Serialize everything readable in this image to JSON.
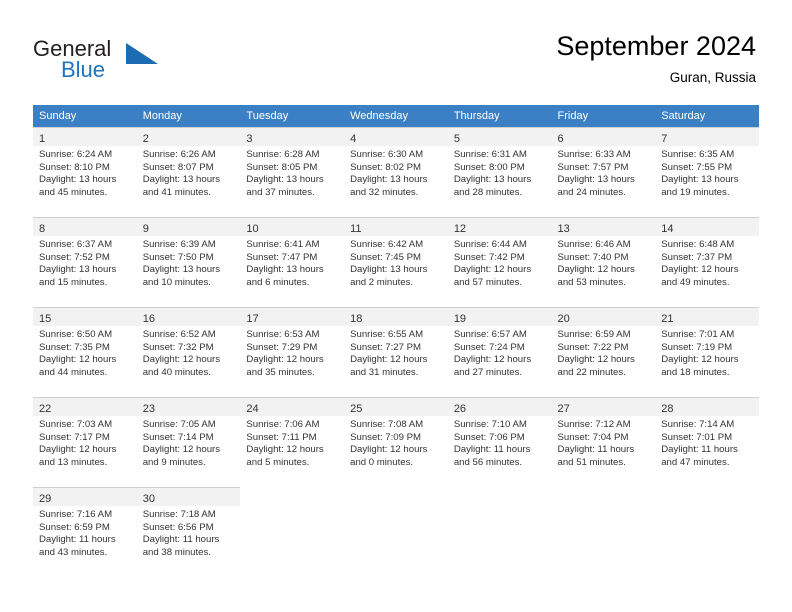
{
  "brand": {
    "name_part1": "General",
    "name_part2": "Blue",
    "logo_icon": "triangle-logo-icon",
    "accent_color": "#2175bc"
  },
  "header": {
    "title": "September 2024",
    "subtitle": "Guran, Russia"
  },
  "calendar": {
    "header_bg_color": "#3b7fc4",
    "weekday_headers": [
      "Sunday",
      "Monday",
      "Tuesday",
      "Wednesday",
      "Thursday",
      "Friday",
      "Saturday"
    ],
    "labels": {
      "sunrise": "Sunrise:",
      "sunset": "Sunset:",
      "daylight": "Daylight:"
    },
    "weeks": [
      [
        {
          "day": "1",
          "sunrise": "Sunrise: 6:24 AM",
          "sunset": "Sunset: 8:10 PM",
          "daylight_1": "Daylight: 13 hours",
          "daylight_2": "and 45 minutes."
        },
        {
          "day": "2",
          "sunrise": "Sunrise: 6:26 AM",
          "sunset": "Sunset: 8:07 PM",
          "daylight_1": "Daylight: 13 hours",
          "daylight_2": "and 41 minutes."
        },
        {
          "day": "3",
          "sunrise": "Sunrise: 6:28 AM",
          "sunset": "Sunset: 8:05 PM",
          "daylight_1": "Daylight: 13 hours",
          "daylight_2": "and 37 minutes."
        },
        {
          "day": "4",
          "sunrise": "Sunrise: 6:30 AM",
          "sunset": "Sunset: 8:02 PM",
          "daylight_1": "Daylight: 13 hours",
          "daylight_2": "and 32 minutes."
        },
        {
          "day": "5",
          "sunrise": "Sunrise: 6:31 AM",
          "sunset": "Sunset: 8:00 PM",
          "daylight_1": "Daylight: 13 hours",
          "daylight_2": "and 28 minutes."
        },
        {
          "day": "6",
          "sunrise": "Sunrise: 6:33 AM",
          "sunset": "Sunset: 7:57 PM",
          "daylight_1": "Daylight: 13 hours",
          "daylight_2": "and 24 minutes."
        },
        {
          "day": "7",
          "sunrise": "Sunrise: 6:35 AM",
          "sunset": "Sunset: 7:55 PM",
          "daylight_1": "Daylight: 13 hours",
          "daylight_2": "and 19 minutes."
        }
      ],
      [
        {
          "day": "8",
          "sunrise": "Sunrise: 6:37 AM",
          "sunset": "Sunset: 7:52 PM",
          "daylight_1": "Daylight: 13 hours",
          "daylight_2": "and 15 minutes."
        },
        {
          "day": "9",
          "sunrise": "Sunrise: 6:39 AM",
          "sunset": "Sunset: 7:50 PM",
          "daylight_1": "Daylight: 13 hours",
          "daylight_2": "and 10 minutes."
        },
        {
          "day": "10",
          "sunrise": "Sunrise: 6:41 AM",
          "sunset": "Sunset: 7:47 PM",
          "daylight_1": "Daylight: 13 hours",
          "daylight_2": "and 6 minutes."
        },
        {
          "day": "11",
          "sunrise": "Sunrise: 6:42 AM",
          "sunset": "Sunset: 7:45 PM",
          "daylight_1": "Daylight: 13 hours",
          "daylight_2": "and 2 minutes."
        },
        {
          "day": "12",
          "sunrise": "Sunrise: 6:44 AM",
          "sunset": "Sunset: 7:42 PM",
          "daylight_1": "Daylight: 12 hours",
          "daylight_2": "and 57 minutes."
        },
        {
          "day": "13",
          "sunrise": "Sunrise: 6:46 AM",
          "sunset": "Sunset: 7:40 PM",
          "daylight_1": "Daylight: 12 hours",
          "daylight_2": "and 53 minutes."
        },
        {
          "day": "14",
          "sunrise": "Sunrise: 6:48 AM",
          "sunset": "Sunset: 7:37 PM",
          "daylight_1": "Daylight: 12 hours",
          "daylight_2": "and 49 minutes."
        }
      ],
      [
        {
          "day": "15",
          "sunrise": "Sunrise: 6:50 AM",
          "sunset": "Sunset: 7:35 PM",
          "daylight_1": "Daylight: 12 hours",
          "daylight_2": "and 44 minutes."
        },
        {
          "day": "16",
          "sunrise": "Sunrise: 6:52 AM",
          "sunset": "Sunset: 7:32 PM",
          "daylight_1": "Daylight: 12 hours",
          "daylight_2": "and 40 minutes."
        },
        {
          "day": "17",
          "sunrise": "Sunrise: 6:53 AM",
          "sunset": "Sunset: 7:29 PM",
          "daylight_1": "Daylight: 12 hours",
          "daylight_2": "and 35 minutes."
        },
        {
          "day": "18",
          "sunrise": "Sunrise: 6:55 AM",
          "sunset": "Sunset: 7:27 PM",
          "daylight_1": "Daylight: 12 hours",
          "daylight_2": "and 31 minutes."
        },
        {
          "day": "19",
          "sunrise": "Sunrise: 6:57 AM",
          "sunset": "Sunset: 7:24 PM",
          "daylight_1": "Daylight: 12 hours",
          "daylight_2": "and 27 minutes."
        },
        {
          "day": "20",
          "sunrise": "Sunrise: 6:59 AM",
          "sunset": "Sunset: 7:22 PM",
          "daylight_1": "Daylight: 12 hours",
          "daylight_2": "and 22 minutes."
        },
        {
          "day": "21",
          "sunrise": "Sunrise: 7:01 AM",
          "sunset": "Sunset: 7:19 PM",
          "daylight_1": "Daylight: 12 hours",
          "daylight_2": "and 18 minutes."
        }
      ],
      [
        {
          "day": "22",
          "sunrise": "Sunrise: 7:03 AM",
          "sunset": "Sunset: 7:17 PM",
          "daylight_1": "Daylight: 12 hours",
          "daylight_2": "and 13 minutes."
        },
        {
          "day": "23",
          "sunrise": "Sunrise: 7:05 AM",
          "sunset": "Sunset: 7:14 PM",
          "daylight_1": "Daylight: 12 hours",
          "daylight_2": "and 9 minutes."
        },
        {
          "day": "24",
          "sunrise": "Sunrise: 7:06 AM",
          "sunset": "Sunset: 7:11 PM",
          "daylight_1": "Daylight: 12 hours",
          "daylight_2": "and 5 minutes."
        },
        {
          "day": "25",
          "sunrise": "Sunrise: 7:08 AM",
          "sunset": "Sunset: 7:09 PM",
          "daylight_1": "Daylight: 12 hours",
          "daylight_2": "and 0 minutes."
        },
        {
          "day": "26",
          "sunrise": "Sunrise: 7:10 AM",
          "sunset": "Sunset: 7:06 PM",
          "daylight_1": "Daylight: 11 hours",
          "daylight_2": "and 56 minutes."
        },
        {
          "day": "27",
          "sunrise": "Sunrise: 7:12 AM",
          "sunset": "Sunset: 7:04 PM",
          "daylight_1": "Daylight: 11 hours",
          "daylight_2": "and 51 minutes."
        },
        {
          "day": "28",
          "sunrise": "Sunrise: 7:14 AM",
          "sunset": "Sunset: 7:01 PM",
          "daylight_1": "Daylight: 11 hours",
          "daylight_2": "and 47 minutes."
        }
      ],
      [
        {
          "day": "29",
          "sunrise": "Sunrise: 7:16 AM",
          "sunset": "Sunset: 6:59 PM",
          "daylight_1": "Daylight: 11 hours",
          "daylight_2": "and 43 minutes."
        },
        {
          "day": "30",
          "sunrise": "Sunrise: 7:18 AM",
          "sunset": "Sunset: 6:56 PM",
          "daylight_1": "Daylight: 11 hours",
          "daylight_2": "and 38 minutes."
        },
        null,
        null,
        null,
        null,
        null
      ]
    ]
  }
}
